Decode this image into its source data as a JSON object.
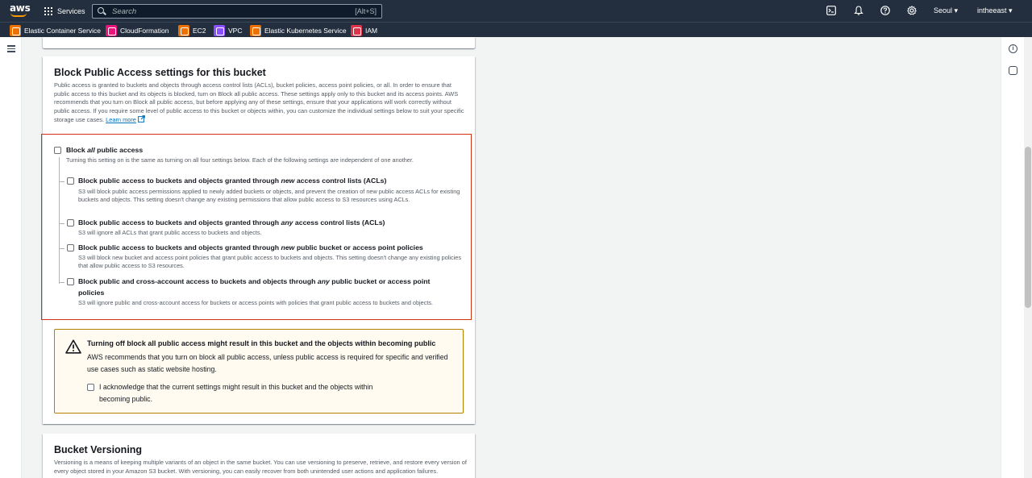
{
  "topnav": {
    "logo": "aws",
    "services_label": "Services",
    "search_placeholder": "Search",
    "search_shortcut": "[Alt+S]",
    "region": "Seoul ▾",
    "account": "intheeast ▾",
    "icons": [
      "terminal-icon",
      "bell-icon",
      "help-icon",
      "gear-icon"
    ]
  },
  "favorites": [
    {
      "label": "Elastic Container Service",
      "color": "#ed7100"
    },
    {
      "label": "CloudFormation",
      "color": "#e7157b"
    },
    {
      "label": "EC2",
      "color": "#ed7100"
    },
    {
      "label": "VPC",
      "color": "#8c4fff"
    },
    {
      "label": "Elastic Kubernetes Service",
      "color": "#ed7100"
    },
    {
      "label": "IAM",
      "color": "#dd344c"
    }
  ],
  "block_public_access": {
    "title": "Block Public Access settings for this bucket",
    "description": "Public access is granted to buckets and objects through access control lists (ACLs), bucket policies, access point policies, or all. In order to ensure that public access to this bucket and its objects is blocked, turn on Block all public access. These settings apply only to this bucket and its access points. AWS recommends that you turn on Block all public access, but before applying any of these settings, ensure that your applications will work correctly without public access. If you require some level of public access to this bucket or objects within, you can customize the individual settings below to suit your specific storage use cases.",
    "learn_more": "Learn more",
    "block_all": {
      "label_pre": "Block ",
      "label_em": "all",
      "label_post": " public access",
      "description": "Turning this setting on is the same as turning on all four settings below. Each of the following settings are independent of one another."
    },
    "options": [
      {
        "title_pre": "Block public access to buckets and objects granted through ",
        "title_em": "new",
        "title_post": " access control lists (ACLs)",
        "description": "S3 will block public access permissions applied to newly added buckets or objects, and prevent the creation of new public access ACLs for existing buckets and objects. This setting doesn't change any existing permissions that allow public access to S3 resources using ACLs."
      },
      {
        "title_pre": "Block public access to buckets and objects granted through ",
        "title_em": "any",
        "title_post": " access control lists (ACLs)",
        "description": "S3 will ignore all ACLs that grant public access to buckets and objects."
      },
      {
        "title_pre": "Block public access to buckets and objects granted through ",
        "title_em": "new",
        "title_post": " public bucket or access point policies",
        "description": "S3 will block new bucket and access point policies that grant public access to buckets and objects. This setting doesn't change any existing policies that allow public access to S3 resources."
      },
      {
        "title_pre": "Block public and cross-account access to buckets and objects through ",
        "title_em": "any",
        "title_post": " public bucket or access point policies",
        "description": "S3 will ignore public and cross-account access for buckets or access points with policies that grant public access to buckets and objects."
      }
    ]
  },
  "warning": {
    "title": "Turning off block all public access might result in this bucket and the objects within becoming public",
    "text": "AWS recommends that you turn on block all public access, unless public access is required for specific and verified use cases such as static website hosting.",
    "acknowledge": "I acknowledge that the current settings might result in this bucket and the objects within becoming public."
  },
  "versioning": {
    "title": "Bucket Versioning",
    "description": "Versioning is a means of keeping multiple variants of an object in the same bucket. You can use versioning to preserve, retrieve, and restore every version of every object stored in your Amazon S3 bucket. With versioning, you can easily recover from both unintended user actions and application failures."
  }
}
